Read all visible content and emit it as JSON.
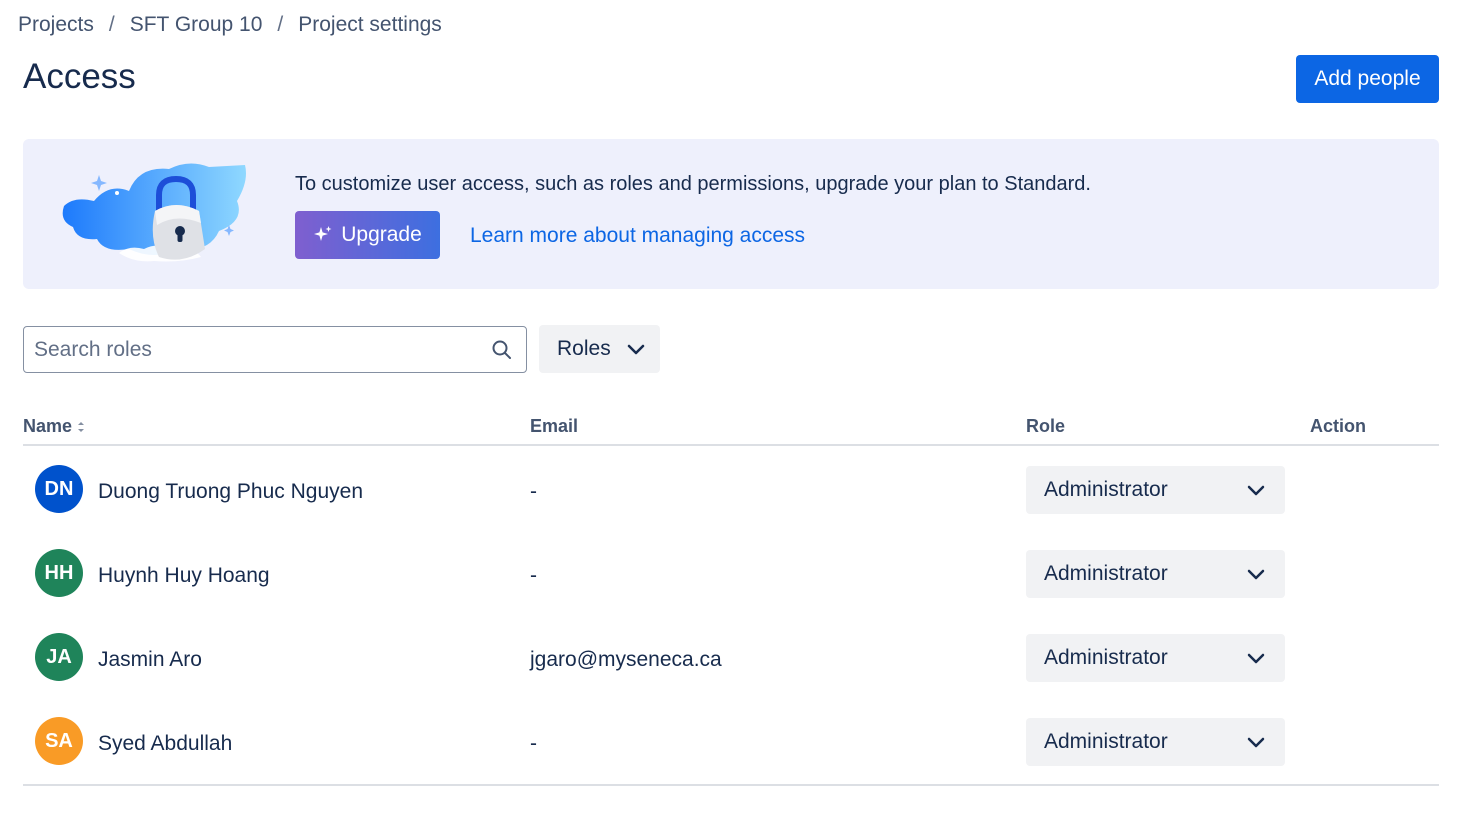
{
  "breadcrumb": {
    "items": [
      "Projects",
      "SFT Group 10",
      "Project settings"
    ],
    "separator": "/"
  },
  "page": {
    "title": "Access",
    "add_people_label": "Add people"
  },
  "banner": {
    "message": "To customize user access, such as roles and permissions, upgrade your plan to Standard.",
    "upgrade_label": "Upgrade",
    "learn_more_label": "Learn more about managing access",
    "illustration_icon": "padlock-illustration"
  },
  "filters": {
    "search_placeholder": "Search roles",
    "search_value": "",
    "roles_label": "Roles"
  },
  "table": {
    "headers": {
      "name": "Name",
      "email": "Email",
      "role": "Role",
      "action": "Action"
    },
    "rows": [
      {
        "initials": "DN",
        "avatar_color": "#0052cc",
        "name": "Duong Truong Phuc Nguyen",
        "email": "-",
        "role": "Administrator"
      },
      {
        "initials": "HH",
        "avatar_color": "#1f845a",
        "name": "Huynh Huy Hoang",
        "email": "-",
        "role": "Administrator"
      },
      {
        "initials": "JA",
        "avatar_color": "#1f845a",
        "name": "Jasmin Aro",
        "email": "jgaro@myseneca.ca",
        "role": "Administrator"
      },
      {
        "initials": "SA",
        "avatar_color": "#f99b26",
        "name": "Syed Abdullah",
        "email": "-",
        "role": "Administrator"
      }
    ]
  },
  "colors": {
    "primary": "#0c66e4",
    "banner_bg": "#eef0fc",
    "text": "#172b4d",
    "subtle_text": "#44546f"
  }
}
